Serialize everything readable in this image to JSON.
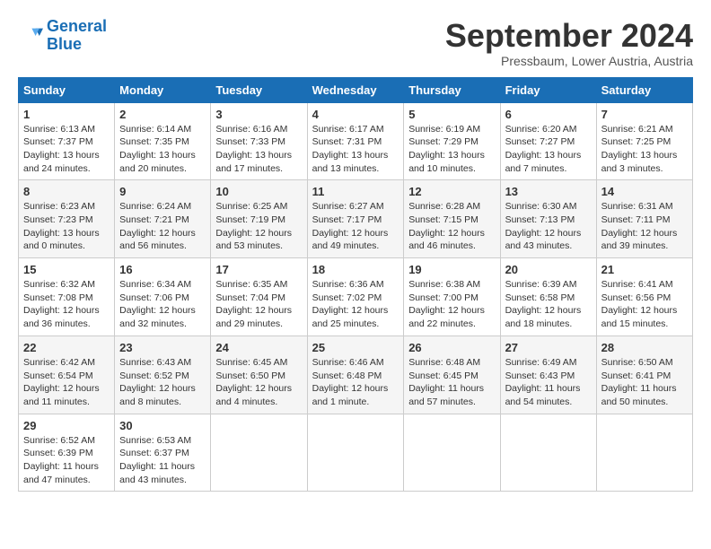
{
  "logo": {
    "line1": "General",
    "line2": "Blue"
  },
  "title": "September 2024",
  "subtitle": "Pressbaum, Lower Austria, Austria",
  "weekdays": [
    "Sunday",
    "Monday",
    "Tuesday",
    "Wednesday",
    "Thursday",
    "Friday",
    "Saturday"
  ],
  "weeks": [
    [
      {
        "day": "1",
        "detail": "Sunrise: 6:13 AM\nSunset: 7:37 PM\nDaylight: 13 hours\nand 24 minutes."
      },
      {
        "day": "2",
        "detail": "Sunrise: 6:14 AM\nSunset: 7:35 PM\nDaylight: 13 hours\nand 20 minutes."
      },
      {
        "day": "3",
        "detail": "Sunrise: 6:16 AM\nSunset: 7:33 PM\nDaylight: 13 hours\nand 17 minutes."
      },
      {
        "day": "4",
        "detail": "Sunrise: 6:17 AM\nSunset: 7:31 PM\nDaylight: 13 hours\nand 13 minutes."
      },
      {
        "day": "5",
        "detail": "Sunrise: 6:19 AM\nSunset: 7:29 PM\nDaylight: 13 hours\nand 10 minutes."
      },
      {
        "day": "6",
        "detail": "Sunrise: 6:20 AM\nSunset: 7:27 PM\nDaylight: 13 hours\nand 7 minutes."
      },
      {
        "day": "7",
        "detail": "Sunrise: 6:21 AM\nSunset: 7:25 PM\nDaylight: 13 hours\nand 3 minutes."
      }
    ],
    [
      {
        "day": "8",
        "detail": "Sunrise: 6:23 AM\nSunset: 7:23 PM\nDaylight: 13 hours\nand 0 minutes."
      },
      {
        "day": "9",
        "detail": "Sunrise: 6:24 AM\nSunset: 7:21 PM\nDaylight: 12 hours\nand 56 minutes."
      },
      {
        "day": "10",
        "detail": "Sunrise: 6:25 AM\nSunset: 7:19 PM\nDaylight: 12 hours\nand 53 minutes."
      },
      {
        "day": "11",
        "detail": "Sunrise: 6:27 AM\nSunset: 7:17 PM\nDaylight: 12 hours\nand 49 minutes."
      },
      {
        "day": "12",
        "detail": "Sunrise: 6:28 AM\nSunset: 7:15 PM\nDaylight: 12 hours\nand 46 minutes."
      },
      {
        "day": "13",
        "detail": "Sunrise: 6:30 AM\nSunset: 7:13 PM\nDaylight: 12 hours\nand 43 minutes."
      },
      {
        "day": "14",
        "detail": "Sunrise: 6:31 AM\nSunset: 7:11 PM\nDaylight: 12 hours\nand 39 minutes."
      }
    ],
    [
      {
        "day": "15",
        "detail": "Sunrise: 6:32 AM\nSunset: 7:08 PM\nDaylight: 12 hours\nand 36 minutes."
      },
      {
        "day": "16",
        "detail": "Sunrise: 6:34 AM\nSunset: 7:06 PM\nDaylight: 12 hours\nand 32 minutes."
      },
      {
        "day": "17",
        "detail": "Sunrise: 6:35 AM\nSunset: 7:04 PM\nDaylight: 12 hours\nand 29 minutes."
      },
      {
        "day": "18",
        "detail": "Sunrise: 6:36 AM\nSunset: 7:02 PM\nDaylight: 12 hours\nand 25 minutes."
      },
      {
        "day": "19",
        "detail": "Sunrise: 6:38 AM\nSunset: 7:00 PM\nDaylight: 12 hours\nand 22 minutes."
      },
      {
        "day": "20",
        "detail": "Sunrise: 6:39 AM\nSunset: 6:58 PM\nDaylight: 12 hours\nand 18 minutes."
      },
      {
        "day": "21",
        "detail": "Sunrise: 6:41 AM\nSunset: 6:56 PM\nDaylight: 12 hours\nand 15 minutes."
      }
    ],
    [
      {
        "day": "22",
        "detail": "Sunrise: 6:42 AM\nSunset: 6:54 PM\nDaylight: 12 hours\nand 11 minutes."
      },
      {
        "day": "23",
        "detail": "Sunrise: 6:43 AM\nSunset: 6:52 PM\nDaylight: 12 hours\nand 8 minutes."
      },
      {
        "day": "24",
        "detail": "Sunrise: 6:45 AM\nSunset: 6:50 PM\nDaylight: 12 hours\nand 4 minutes."
      },
      {
        "day": "25",
        "detail": "Sunrise: 6:46 AM\nSunset: 6:48 PM\nDaylight: 12 hours\nand 1 minute."
      },
      {
        "day": "26",
        "detail": "Sunrise: 6:48 AM\nSunset: 6:45 PM\nDaylight: 11 hours\nand 57 minutes."
      },
      {
        "day": "27",
        "detail": "Sunrise: 6:49 AM\nSunset: 6:43 PM\nDaylight: 11 hours\nand 54 minutes."
      },
      {
        "day": "28",
        "detail": "Sunrise: 6:50 AM\nSunset: 6:41 PM\nDaylight: 11 hours\nand 50 minutes."
      }
    ],
    [
      {
        "day": "29",
        "detail": "Sunrise: 6:52 AM\nSunset: 6:39 PM\nDaylight: 11 hours\nand 47 minutes."
      },
      {
        "day": "30",
        "detail": "Sunrise: 6:53 AM\nSunset: 6:37 PM\nDaylight: 11 hours\nand 43 minutes."
      },
      {
        "day": "",
        "detail": ""
      },
      {
        "day": "",
        "detail": ""
      },
      {
        "day": "",
        "detail": ""
      },
      {
        "day": "",
        "detail": ""
      },
      {
        "day": "",
        "detail": ""
      }
    ]
  ]
}
